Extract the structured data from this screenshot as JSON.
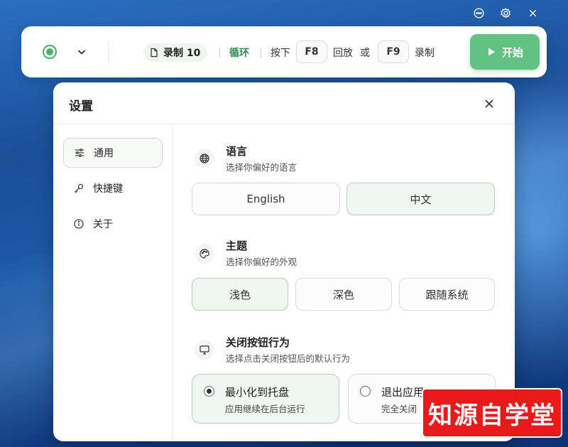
{
  "toolbar": {
    "record_label": "录制 10",
    "loop_label": "循环",
    "press_label": "按下",
    "playback_key": "F8",
    "playback_label": "回放",
    "or_label": "或",
    "record_key": "F9",
    "record_action_label": "录制",
    "start_label": "开始"
  },
  "dialog": {
    "title": "设置"
  },
  "sidebar": {
    "items": [
      {
        "label": "通用",
        "icon": "sliders-icon",
        "active": true
      },
      {
        "label": "快捷键",
        "icon": "key-icon",
        "active": false
      },
      {
        "label": "关于",
        "icon": "info-icon",
        "active": false
      }
    ]
  },
  "language": {
    "title": "语言",
    "subtitle": "选择你偏好的语言",
    "options": [
      "English",
      "中文"
    ],
    "selected": "中文"
  },
  "theme": {
    "title": "主题",
    "subtitle": "选择你偏好的外观",
    "options": [
      "浅色",
      "深色",
      "跟随系统"
    ],
    "selected": "浅色"
  },
  "close_behavior": {
    "title": "关闭按钮行为",
    "subtitle": "选择点击关闭按钮后的默认行为",
    "options": [
      {
        "label": "最小化到托盘",
        "desc": "应用继续在后台运行",
        "selected": true
      },
      {
        "label": "退出应用",
        "desc": "完全关闭",
        "selected": false
      }
    ]
  },
  "watermark": "知源自学堂",
  "colors": {
    "accent": "#63c183",
    "accent_dark": "#2f8a4a",
    "selected_bg": "#eff7f0"
  }
}
